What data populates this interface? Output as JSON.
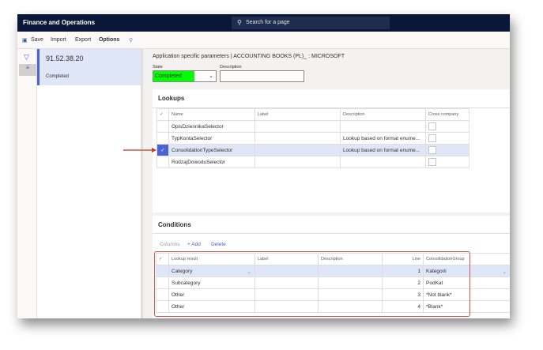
{
  "app": {
    "title": "Finance and Operations",
    "search_placeholder": "Search for a page"
  },
  "toolbar": {
    "save": "Save",
    "import": "Import",
    "export": "Export",
    "options": "Options"
  },
  "list": {
    "item_title": "91.52.38.20",
    "item_status": "Completed"
  },
  "main": {
    "breadcrumb": "Application specific parameters  |  ACCOUNTING BOOKS (PL)_ : MICROSOFT",
    "state_label": "State",
    "state_value": "Completed",
    "state_color": "#00ff00",
    "description_label": "Description",
    "description_value": ""
  },
  "lookups": {
    "title": "Lookups",
    "columns": [
      "Name",
      "Label",
      "Description",
      "Cross company"
    ],
    "rows": [
      {
        "name": "OpisDziennikaSelector",
        "label": "",
        "description": ""
      },
      {
        "name": "TypKontaSelector",
        "label": "",
        "description": "Lookup based on format enume..."
      },
      {
        "name": "ConsolidationTypeSelector",
        "label": "",
        "description": "Lookup based on format enume...",
        "selected": true
      },
      {
        "name": "RodzajDowoduSelector",
        "label": "",
        "description": ""
      }
    ]
  },
  "conditions": {
    "title": "Conditions",
    "actions": {
      "columns": "Columns",
      "add": "+ Add",
      "delete": "Delete"
    },
    "columns": [
      "Lookup result",
      "Label",
      "Description",
      "Line",
      "ConsolidationGroup"
    ],
    "rows": [
      {
        "result": "Category",
        "label": "",
        "description": "",
        "line": "1",
        "group": "Kategorii"
      },
      {
        "result": "Subcategory",
        "label": "",
        "description": "",
        "line": "2",
        "group": "PodKat"
      },
      {
        "result": "Other",
        "label": "",
        "description": "",
        "line": "3",
        "group": "*Not blank*"
      },
      {
        "result": "Other",
        "label": "",
        "description": "",
        "line": "4",
        "group": "*Blank*"
      }
    ]
  },
  "annotation": {
    "highlight_color": "#d9534f"
  }
}
